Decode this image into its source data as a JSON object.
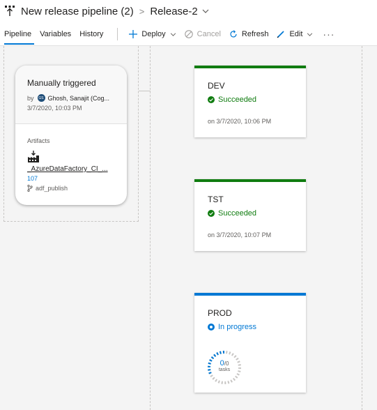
{
  "header": {
    "pipeline_name": "New release pipeline (2)",
    "release_name": "Release-2"
  },
  "tabs": [
    {
      "label": "Pipeline",
      "active": true
    },
    {
      "label": "Variables",
      "active": false
    },
    {
      "label": "History",
      "active": false
    }
  ],
  "toolbar": {
    "deploy_label": "Deploy",
    "cancel_label": "Cancel",
    "refresh_label": "Refresh",
    "edit_label": "Edit",
    "more_label": "···"
  },
  "artifact_card": {
    "trigger_title": "Manually triggered",
    "by_label": "by",
    "avatar_initials": "GS",
    "user_name": "Ghosh, Sanajit (Cog...",
    "trigger_date": "3/7/2020, 10:03 PM",
    "artifacts_label": "Artifacts",
    "artifact_icon": "factory-icon",
    "artifact_name": "_AzureDataFactory_CI_...",
    "artifact_version": "107",
    "artifact_branch": "adf_publish"
  },
  "stages": [
    {
      "name": "DEV",
      "status": "Succeeded",
      "status_color": "#107c10",
      "status_icon": "check-circle-icon",
      "date": "on 3/7/2020, 10:06 PM"
    },
    {
      "name": "TST",
      "status": "Succeeded",
      "status_color": "#107c10",
      "status_icon": "check-circle-icon",
      "date": "on 3/7/2020, 10:07 PM"
    },
    {
      "name": "PROD",
      "status": "In progress",
      "status_color": "#0078d4",
      "status_icon": "in-progress-icon",
      "tasks_done": "0",
      "tasks_total": "/0",
      "tasks_label": "tasks"
    }
  ],
  "colors": {
    "accent": "#0078d4",
    "success": "#107c10"
  }
}
